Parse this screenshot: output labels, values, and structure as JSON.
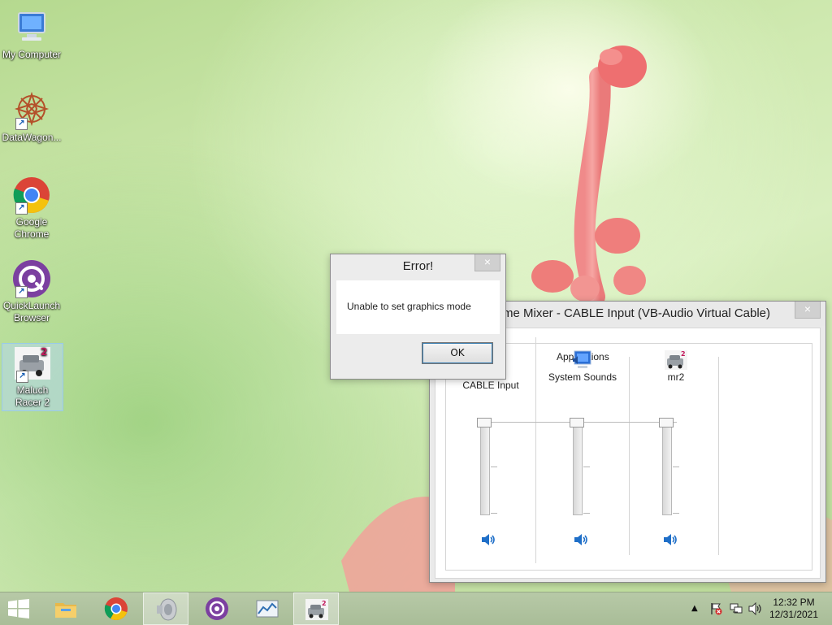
{
  "desktop": {
    "icons": [
      {
        "label": "My Computer"
      },
      {
        "label": "DataWagon..."
      },
      {
        "label": "Google Chrome"
      },
      {
        "label": "QuickLaunch Browser"
      },
      {
        "label": "Maluch Racer 2",
        "selected": true
      }
    ]
  },
  "error_dialog": {
    "title": "Error!",
    "message": "Unable to set graphics mode",
    "ok_label": "OK",
    "close_glyph": "×"
  },
  "mixer": {
    "title": "me Mixer - CABLE Input (VB-Audio Virtual Cable)",
    "close_glyph": "×",
    "applications_label": "Applications",
    "channels": [
      {
        "name": "CABLE Input",
        "icon": "cable-input-icon",
        "level": 1.0
      },
      {
        "name": "System Sounds",
        "icon": "system-sounds-icon",
        "level": 1.0
      },
      {
        "name": "mr2",
        "icon": "mr2-app-icon",
        "level": 1.0
      }
    ]
  },
  "taskbar": {
    "start_icon": "windows-start-icon",
    "pinned": [
      {
        "name": "file-explorer-icon"
      },
      {
        "name": "chrome-icon"
      },
      {
        "name": "volume-mixer-taskbar-icon",
        "active": true
      },
      {
        "name": "quicklaunch-icon"
      },
      {
        "name": "graph-app-icon"
      },
      {
        "name": "maluch-racer-icon",
        "active": true
      }
    ],
    "clock_time": "12:32 PM",
    "clock_date": "12/31/2021"
  },
  "colors": {
    "chrome_red": "#db4437",
    "chrome_yellow": "#f4c20d",
    "chrome_green": "#0f9d58",
    "chrome_blue": "#4285f4",
    "quicklaunch_purple": "#7b3fa0",
    "speaker_blue": "#1f6fc8"
  }
}
